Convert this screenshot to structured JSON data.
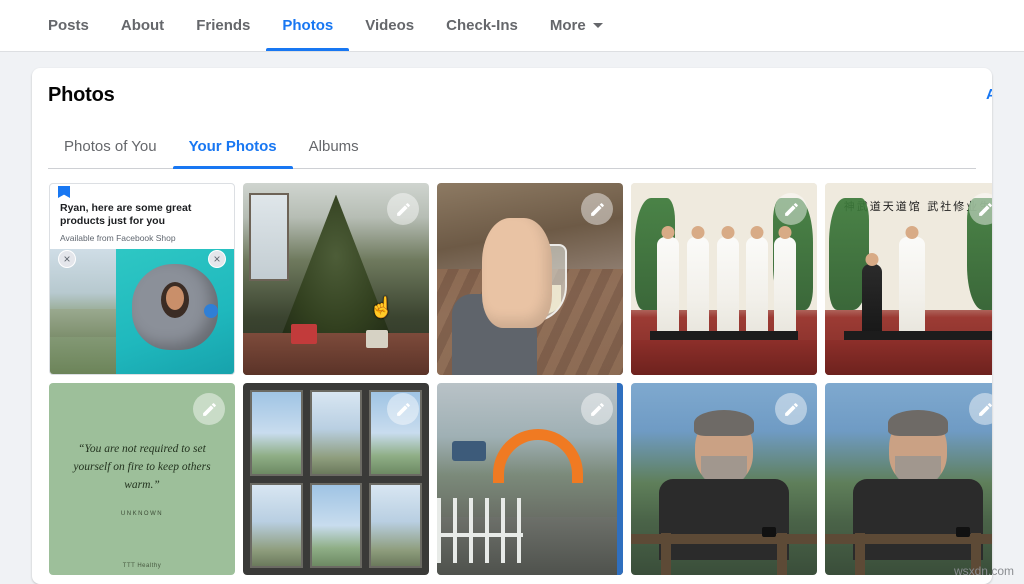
{
  "topnav": {
    "items": [
      {
        "label": "Posts",
        "active": false
      },
      {
        "label": "About",
        "active": false
      },
      {
        "label": "Friends",
        "active": false
      },
      {
        "label": "Photos",
        "active": true
      },
      {
        "label": "Videos",
        "active": false
      },
      {
        "label": "Check-Ins",
        "active": false
      },
      {
        "label": "More",
        "active": false,
        "caret": true
      }
    ]
  },
  "card": {
    "title": "Photos",
    "add_label": "Ad",
    "tabs": [
      {
        "label": "Photos of You",
        "active": false
      },
      {
        "label": "Your Photos",
        "active": true
      },
      {
        "label": "Albums",
        "active": false
      }
    ]
  },
  "ad": {
    "headline": "Ryan, here are some great products just for you",
    "subtext": "Available from Facebook Shop",
    "close_label": "×"
  },
  "quote": {
    "text": "“You are not required to set yourself on fire to keep others warm.”",
    "attribution": "UNKNOWN",
    "brand": "TTT Healthy"
  },
  "dragon": {
    "banner_text": "神武道天道馆 武社修业生"
  },
  "icons": {
    "edit": "pencil-icon",
    "cursor": "hand-pointer-cursor"
  },
  "colors": {
    "accent": "#1877f2",
    "page_bg": "#f0f2f5",
    "card_bg": "#ffffff",
    "muted_text": "#65676b"
  },
  "watermark": "wsxdn.com"
}
